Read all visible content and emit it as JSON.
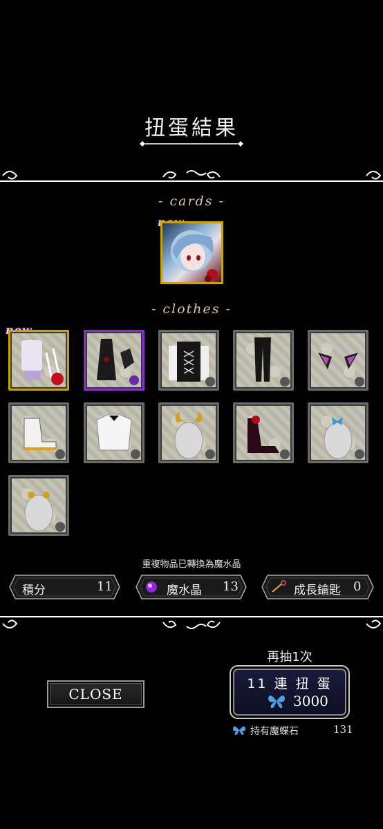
{
  "header": {
    "title": "扭蛋結果"
  },
  "sections": {
    "cards_label": "- cards -",
    "clothes_label": "- clothes -"
  },
  "new_tag": "new",
  "note": "重複物品已轉換為魔水晶",
  "stats": {
    "points_label": "積分",
    "points_value": "11",
    "crystal_label": "魔水晶",
    "crystal_value": "13",
    "key_label": "成長鑰匙",
    "key_value": "0"
  },
  "actions": {
    "close_label": "CLOSE",
    "again_label": "再抽1次",
    "gacha_label": "11 連 扭 蛋",
    "gacha_price": "3000",
    "owned_label": "持有魔蝶石",
    "owned_value": "131"
  },
  "icons": [
    "sparkle-icon",
    "rose-icon",
    "crystal-icon",
    "key-icon",
    "butterfly-icon"
  ],
  "colors": {
    "gold_frame": "#c9a400",
    "purple_frame": "#8d2bd6",
    "gray_frame": "#6a6a6a",
    "accent_text": "#d6c7ad"
  }
}
